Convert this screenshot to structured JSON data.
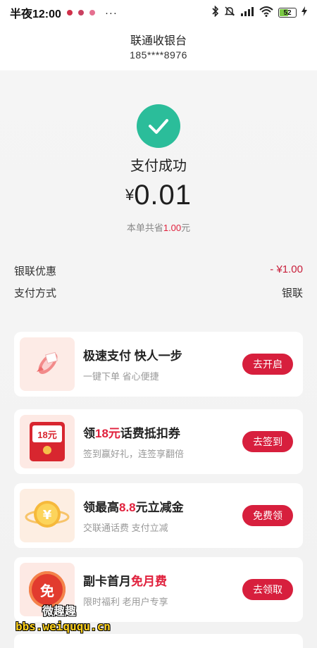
{
  "status_bar": {
    "time": "半夜12:00",
    "more": "···",
    "battery": "52"
  },
  "header": {
    "title": "联通收银台",
    "phone": "185****8976"
  },
  "result": {
    "title": "支付成功",
    "currency": "¥",
    "amount": "0.01",
    "saved_prefix": "本单共省",
    "saved_amount": "1.00",
    "saved_unit": "元"
  },
  "details": [
    {
      "label": "银联优惠",
      "value": "- ¥1.00"
    },
    {
      "label": "支付方式",
      "value": "银联"
    }
  ],
  "promos": [
    {
      "title_a": "极速支付  快人一步",
      "title_hl": "",
      "title_b": "",
      "subtitle": "一键下单  省心便捷",
      "button": "去开启",
      "icon": "rocket-icon"
    },
    {
      "title_a": "领",
      "title_hl": "18元",
      "title_b": "话费抵扣券",
      "subtitle": "签到赢好礼，连签享翻倍",
      "button": "去签到",
      "icon": "red-envelope-icon",
      "badge": "18元"
    },
    {
      "title_a": "领最高",
      "title_hl": "8.8",
      "title_b": "元立减金",
      "subtitle": "交联通话费  支付立减",
      "button": "免费领",
      "icon": "yuan-coin-icon"
    },
    {
      "title_a": "副卡首月",
      "title_hl": "免月费",
      "title_b": "",
      "subtitle": "限时福利  老用户专享",
      "button": "去领取",
      "icon": "free-badge-icon",
      "badge": "免"
    }
  ],
  "watermark": {
    "line1": "微趣趣",
    "line2": "bbs.weiququ.cn"
  },
  "colors": {
    "accent": "#d71f3d",
    "success": "#2bbd9a",
    "highlight": "#e0203c"
  }
}
